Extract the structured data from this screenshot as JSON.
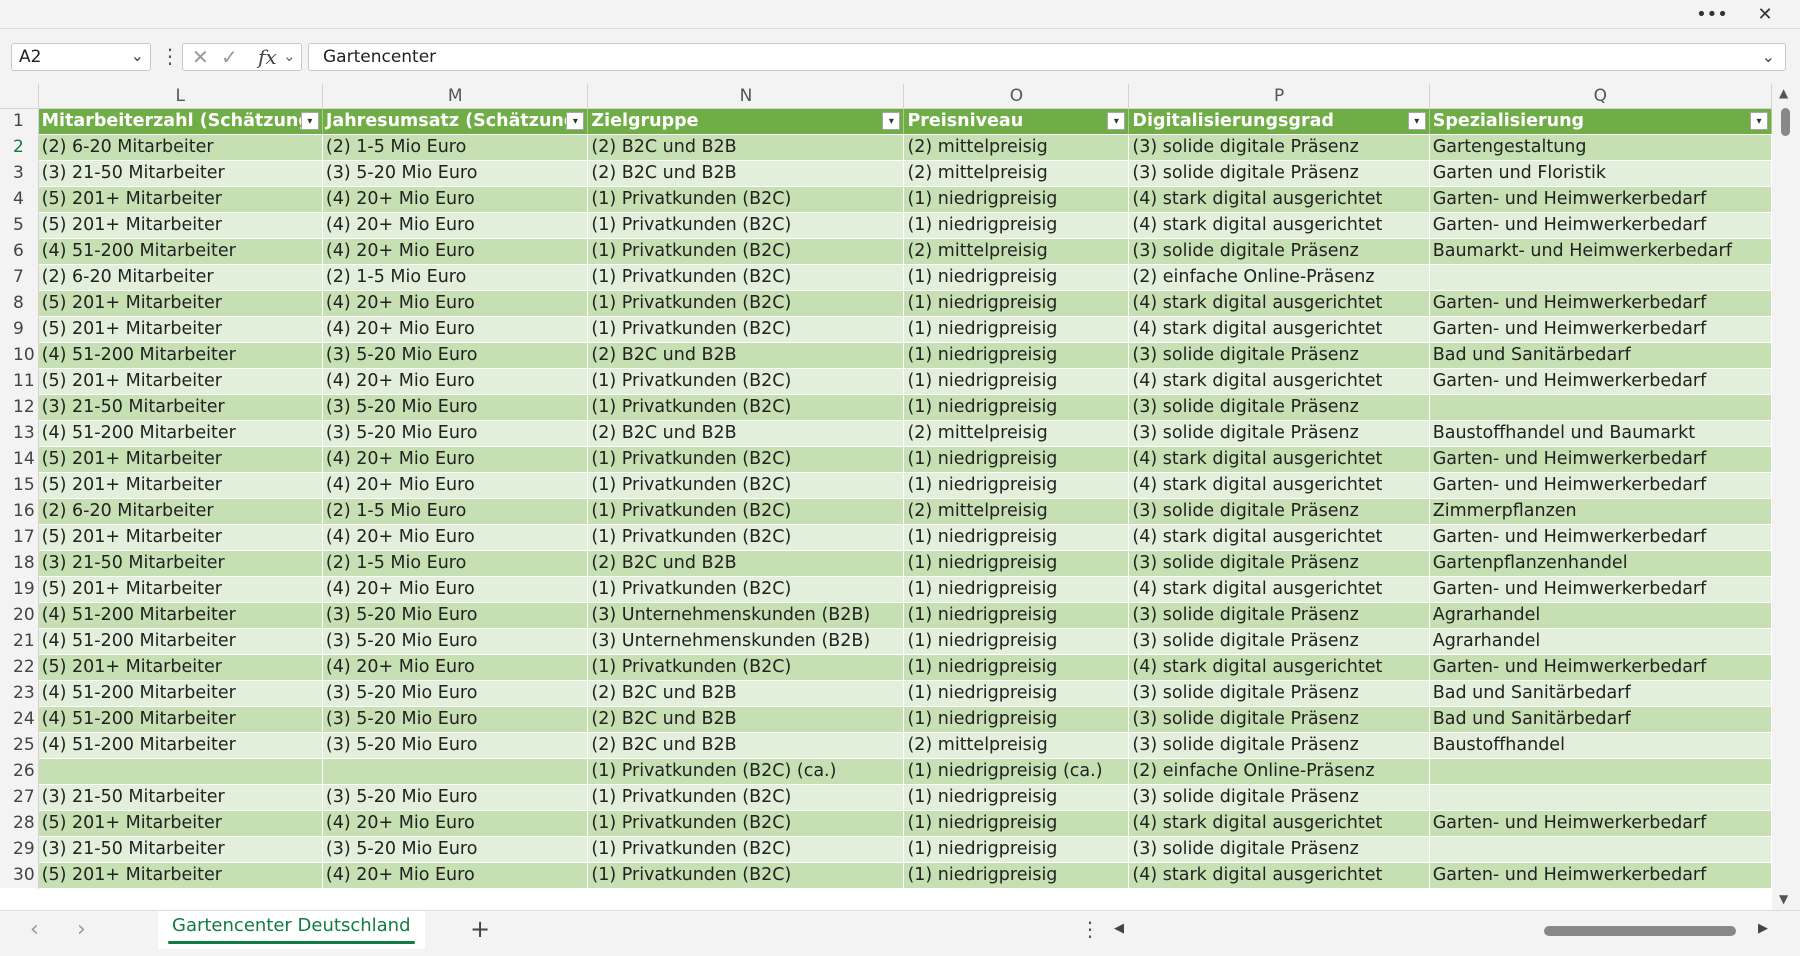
{
  "window": {
    "more_label": "•••",
    "close_label": "✕"
  },
  "formula_bar": {
    "name_box": "A2",
    "content": "Gartencenter",
    "icons": [
      "cancel-icon",
      "confirm-icon",
      "fx-icon"
    ]
  },
  "columns": [
    "L",
    "M",
    "N",
    "O",
    "P",
    "Q"
  ],
  "headers": [
    "Mitarbeiterzahl (Schätzung)",
    "Jahresumsatz (Schätzung)",
    "Zielgruppe",
    "Preisniveau",
    "Digitalisierungsgrad",
    "Spezialisierung"
  ],
  "rows": [
    {
      "n": "2",
      "c": [
        "(2) 6-20 Mitarbeiter",
        "(2) 1-5 Mio Euro",
        "(2) B2C und B2B",
        "(2) mittelpreisig",
        "(3) solide digitale Präsenz",
        "Gartengestaltung"
      ]
    },
    {
      "n": "3",
      "c": [
        "(3) 21-50 Mitarbeiter",
        "(3) 5-20 Mio Euro",
        "(2) B2C und B2B",
        "(2) mittelpreisig",
        "(3) solide digitale Präsenz",
        "Garten und Floristik"
      ]
    },
    {
      "n": "4",
      "c": [
        "(5) 201+ Mitarbeiter",
        "(4) 20+ Mio Euro",
        "(1) Privatkunden (B2C)",
        "(1) niedrigpreisig",
        "(4) stark digital ausgerichtet",
        "Garten- und Heimwerkerbedarf"
      ]
    },
    {
      "n": "5",
      "c": [
        "(5) 201+ Mitarbeiter",
        "(4) 20+ Mio Euro",
        "(1) Privatkunden (B2C)",
        "(1) niedrigpreisig",
        "(4) stark digital ausgerichtet",
        "Garten- und Heimwerkerbedarf"
      ]
    },
    {
      "n": "6",
      "c": [
        "(4) 51-200 Mitarbeiter",
        "(4) 20+ Mio Euro",
        "(1) Privatkunden (B2C)",
        "(2) mittelpreisig",
        "(3) solide digitale Präsenz",
        "Baumarkt- und Heimwerkerbedarf"
      ]
    },
    {
      "n": "7",
      "c": [
        "(2) 6-20 Mitarbeiter",
        "(2) 1-5 Mio Euro",
        "(1) Privatkunden (B2C)",
        "(1) niedrigpreisig",
        "(2) einfache Online-Präsenz",
        ""
      ]
    },
    {
      "n": "8",
      "c": [
        "(5) 201+ Mitarbeiter",
        "(4) 20+ Mio Euro",
        "(1) Privatkunden (B2C)",
        "(1) niedrigpreisig",
        "(4) stark digital ausgerichtet",
        "Garten- und Heimwerkerbedarf"
      ]
    },
    {
      "n": "9",
      "c": [
        "(5) 201+ Mitarbeiter",
        "(4) 20+ Mio Euro",
        "(1) Privatkunden (B2C)",
        "(1) niedrigpreisig",
        "(4) stark digital ausgerichtet",
        "Garten- und Heimwerkerbedarf"
      ]
    },
    {
      "n": "10",
      "c": [
        "(4) 51-200 Mitarbeiter",
        "(3) 5-20 Mio Euro",
        "(2) B2C und B2B",
        "(1) niedrigpreisig",
        "(3) solide digitale Präsenz",
        "Bad und Sanitärbedarf"
      ]
    },
    {
      "n": "11",
      "c": [
        "(5) 201+ Mitarbeiter",
        "(4) 20+ Mio Euro",
        "(1) Privatkunden (B2C)",
        "(1) niedrigpreisig",
        "(4) stark digital ausgerichtet",
        "Garten- und Heimwerkerbedarf"
      ]
    },
    {
      "n": "12",
      "c": [
        "(3) 21-50 Mitarbeiter",
        "(3) 5-20 Mio Euro",
        "(1) Privatkunden (B2C)",
        "(1) niedrigpreisig",
        "(3) solide digitale Präsenz",
        ""
      ]
    },
    {
      "n": "13",
      "c": [
        "(4) 51-200 Mitarbeiter",
        "(3) 5-20 Mio Euro",
        "(2) B2C und B2B",
        "(2) mittelpreisig",
        "(3) solide digitale Präsenz",
        "Baustoffhandel und Baumarkt"
      ]
    },
    {
      "n": "14",
      "c": [
        "(5) 201+ Mitarbeiter",
        "(4) 20+ Mio Euro",
        "(1) Privatkunden (B2C)",
        "(1) niedrigpreisig",
        "(4) stark digital ausgerichtet",
        "Garten- und Heimwerkerbedarf"
      ]
    },
    {
      "n": "15",
      "c": [
        "(5) 201+ Mitarbeiter",
        "(4) 20+ Mio Euro",
        "(1) Privatkunden (B2C)",
        "(1) niedrigpreisig",
        "(4) stark digital ausgerichtet",
        "Garten- und Heimwerkerbedarf"
      ]
    },
    {
      "n": "16",
      "c": [
        "(2) 6-20 Mitarbeiter",
        "(2) 1-5 Mio Euro",
        "(1) Privatkunden (B2C)",
        "(2) mittelpreisig",
        "(3) solide digitale Präsenz",
        "Zimmerpflanzen"
      ]
    },
    {
      "n": "17",
      "c": [
        "(5) 201+ Mitarbeiter",
        "(4) 20+ Mio Euro",
        "(1) Privatkunden (B2C)",
        "(1) niedrigpreisig",
        "(4) stark digital ausgerichtet",
        "Garten- und Heimwerkerbedarf"
      ]
    },
    {
      "n": "18",
      "c": [
        "(3) 21-50 Mitarbeiter",
        "(2) 1-5 Mio Euro",
        "(2) B2C und B2B",
        "(1) niedrigpreisig",
        "(3) solide digitale Präsenz",
        "Gartenpflanzenhandel"
      ]
    },
    {
      "n": "19",
      "c": [
        "(5) 201+ Mitarbeiter",
        "(4) 20+ Mio Euro",
        "(1) Privatkunden (B2C)",
        "(1) niedrigpreisig",
        "(4) stark digital ausgerichtet",
        "Garten- und Heimwerkerbedarf"
      ]
    },
    {
      "n": "20",
      "c": [
        "(4) 51-200 Mitarbeiter",
        "(3) 5-20 Mio Euro",
        "(3) Unternehmenskunden (B2B)",
        "(1) niedrigpreisig",
        "(3) solide digitale Präsenz",
        "Agrarhandel"
      ]
    },
    {
      "n": "21",
      "c": [
        "(4) 51-200 Mitarbeiter",
        "(3) 5-20 Mio Euro",
        "(3) Unternehmenskunden (B2B)",
        "(1) niedrigpreisig",
        "(3) solide digitale Präsenz",
        "Agrarhandel"
      ]
    },
    {
      "n": "22",
      "c": [
        "(5) 201+ Mitarbeiter",
        "(4) 20+ Mio Euro",
        "(1) Privatkunden (B2C)",
        "(1) niedrigpreisig",
        "(4) stark digital ausgerichtet",
        "Garten- und Heimwerkerbedarf"
      ]
    },
    {
      "n": "23",
      "c": [
        "(4) 51-200 Mitarbeiter",
        "(3) 5-20 Mio Euro",
        "(2) B2C und B2B",
        "(1) niedrigpreisig",
        "(3) solide digitale Präsenz",
        "Bad und Sanitärbedarf"
      ]
    },
    {
      "n": "24",
      "c": [
        "(4) 51-200 Mitarbeiter",
        "(3) 5-20 Mio Euro",
        "(2) B2C und B2B",
        "(1) niedrigpreisig",
        "(3) solide digitale Präsenz",
        "Bad und Sanitärbedarf"
      ]
    },
    {
      "n": "25",
      "c": [
        "(4) 51-200 Mitarbeiter",
        "(3) 5-20 Mio Euro",
        "(2) B2C und B2B",
        "(2) mittelpreisig",
        "(3) solide digitale Präsenz",
        "Baustoffhandel"
      ]
    },
    {
      "n": "26",
      "c": [
        "",
        "",
        "(1) Privatkunden (B2C) (ca.)",
        "(1) niedrigpreisig (ca.)",
        "(2) einfache Online-Präsenz",
        ""
      ]
    },
    {
      "n": "27",
      "c": [
        "(3) 21-50 Mitarbeiter",
        "(3) 5-20 Mio Euro",
        "(1) Privatkunden (B2C)",
        "(1) niedrigpreisig",
        "(3) solide digitale Präsenz",
        ""
      ]
    },
    {
      "n": "28",
      "c": [
        "(5) 201+ Mitarbeiter",
        "(4) 20+ Mio Euro",
        "(1) Privatkunden (B2C)",
        "(1) niedrigpreisig",
        "(4) stark digital ausgerichtet",
        "Garten- und Heimwerkerbedarf"
      ]
    },
    {
      "n": "29",
      "c": [
        "(3) 21-50 Mitarbeiter",
        "(3) 5-20 Mio Euro",
        "(1) Privatkunden (B2C)",
        "(1) niedrigpreisig",
        "(3) solide digitale Präsenz",
        ""
      ]
    },
    {
      "n": "30",
      "c": [
        "(5) 201+ Mitarbeiter",
        "(4) 20+ Mio Euro",
        "(1) Privatkunden (B2C)",
        "(1) niedrigpreisig",
        "(4) stark digital ausgerichtet",
        "Garten- und Heimwerkerbedarf"
      ]
    }
  ],
  "sheet_tabs": [
    "Gartencenter Deutschland"
  ],
  "colors": {
    "header_green": "#70ad47",
    "band_dark": "#c6e0b4",
    "band_light": "#e2efda",
    "accent": "#107c41"
  }
}
